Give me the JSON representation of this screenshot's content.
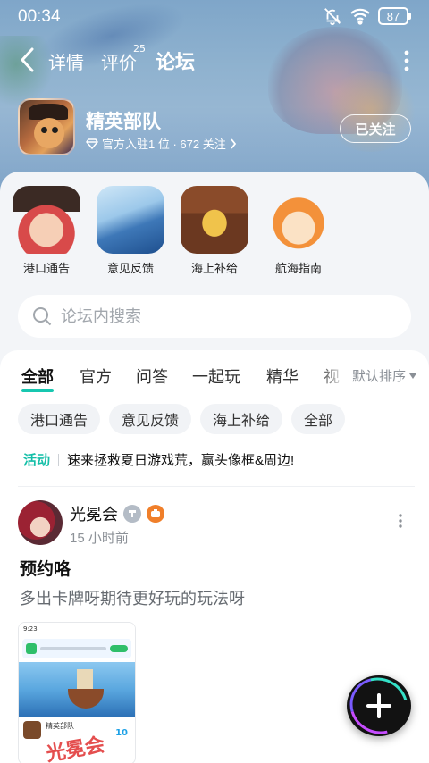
{
  "status_bar": {
    "time": "00:34",
    "battery": "87"
  },
  "nav": {
    "tabs": [
      {
        "label": "详情"
      },
      {
        "label": "评价",
        "badge": "25"
      },
      {
        "label": "论坛"
      }
    ],
    "active_tab": "论坛"
  },
  "game": {
    "name": "精英部队",
    "subtitle": "官方入驻1 位 · 672 关注",
    "follow_label": "已关注"
  },
  "sections": [
    {
      "label": "港口通告",
      "icon": "pirate-girl-icon"
    },
    {
      "label": "意见反馈",
      "icon": "swordfish-icon"
    },
    {
      "label": "海上补给",
      "icon": "treasure-chest-icon"
    },
    {
      "label": "航海指南",
      "icon": "fox-girl-icon"
    }
  ],
  "search": {
    "placeholder": "论坛内搜索"
  },
  "feed_tabs": [
    "全部",
    "官方",
    "问答",
    "一起玩",
    "精华",
    "视"
  ],
  "feed_active_tab": "全部",
  "sort_label": "默认排序",
  "chips": [
    "港口通告",
    "意见反馈",
    "海上补给",
    "全部"
  ],
  "activity": {
    "tag": "活动",
    "text": "速来拯救夏日游戏荒，赢头像框&周边!"
  },
  "post": {
    "author": "光冕会",
    "time": "15 小时前",
    "title": "预约咯",
    "body": "多出卡牌呀期待更好玩的玩法呀",
    "image": {
      "top_time": "9:23",
      "app_name": "精英部队",
      "number": "10",
      "watermark": "光冕会"
    }
  },
  "colors": {
    "accent": "#17c7b0",
    "activity_tag": "#15bfa8",
    "fab": "#121212"
  }
}
